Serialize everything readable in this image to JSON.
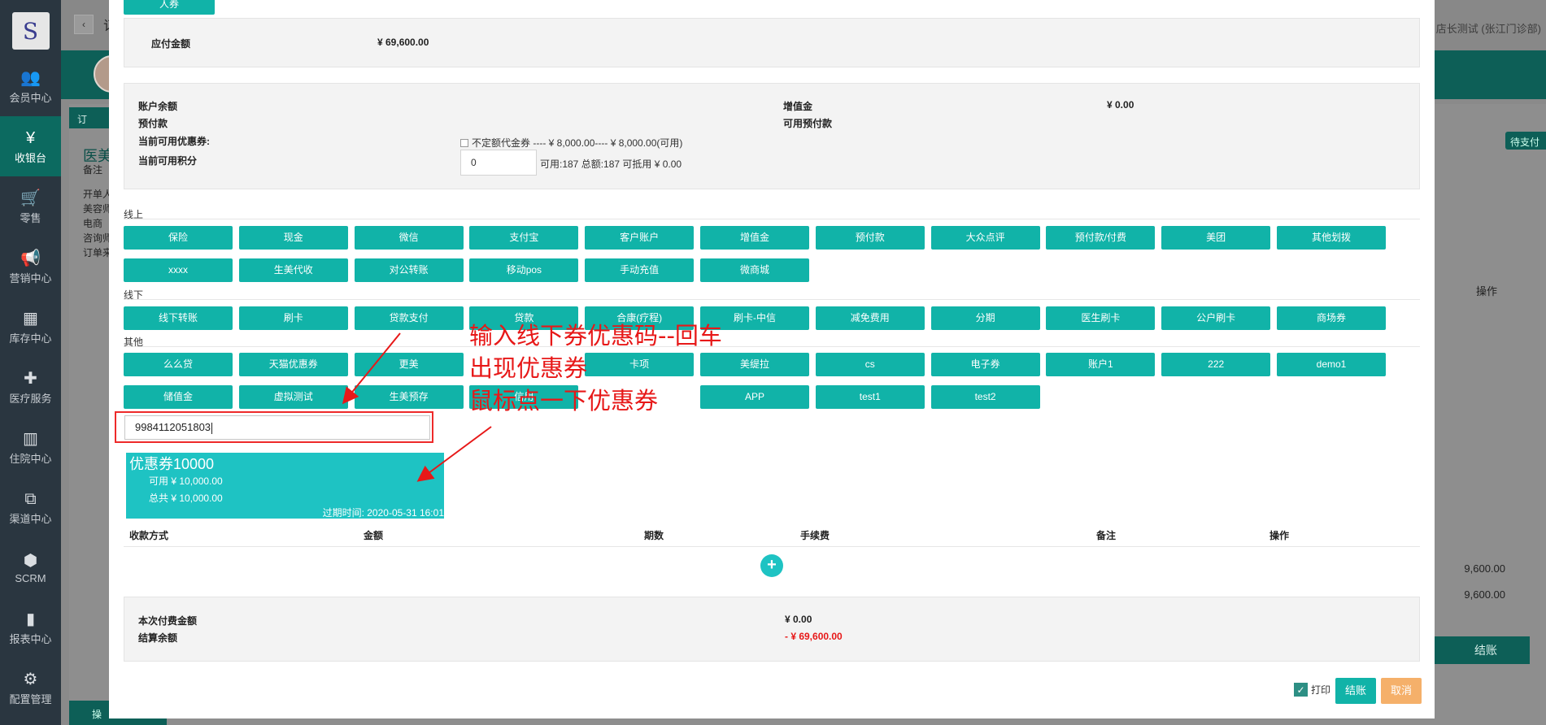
{
  "sidebar": {
    "logo_glyph": "S",
    "items": [
      {
        "label": "会员中心",
        "icon": "users-icon",
        "glyph": "👥"
      },
      {
        "label": "收银台",
        "icon": "yen-icon",
        "glyph": "¥"
      },
      {
        "label": "零售",
        "icon": "cart-icon",
        "glyph": "🛒"
      },
      {
        "label": "营销中心",
        "icon": "megaphone-icon",
        "glyph": "📢"
      },
      {
        "label": "库存中心",
        "icon": "grid-icon",
        "glyph": "▦"
      },
      {
        "label": "医疗服务",
        "icon": "medkit-icon",
        "glyph": "✚"
      },
      {
        "label": "住院中心",
        "icon": "building-icon",
        "glyph": "▥"
      },
      {
        "label": "渠道中心",
        "icon": "sitemap-icon",
        "glyph": "⧉"
      },
      {
        "label": "SCRM",
        "icon": "cubes-icon",
        "glyph": "⬢"
      },
      {
        "label": "报表中心",
        "icon": "bar-chart-icon",
        "glyph": "▮"
      },
      {
        "label": "配置管理",
        "icon": "gear-icon",
        "glyph": "⚙"
      }
    ]
  },
  "background": {
    "title_fragment": "订",
    "user_name": "店长测试 (张江门诊部)",
    "tab_fragment": "订",
    "card_title_fragment": "医美",
    "left_labels": [
      "备注",
      "",
      "开单人",
      "美容师",
      "电商",
      "咨询师",
      "订单来"
    ],
    "pending_badge": "待支付",
    "op_header": "操作",
    "amounts": [
      "9,600.00",
      "9,600.00"
    ],
    "checkout_label": "结账",
    "bottom_tab": "操"
  },
  "modal": {
    "top_button": "人券",
    "payable_label": "应付金额",
    "payable_value": "¥ 69,600.00",
    "account": {
      "balance_label": "账户余额",
      "prepaid_label": "预付款",
      "coupons_label": "当前可用优惠券:",
      "points_label": "当前可用积分",
      "value_added_label": "增值金",
      "value_added_value": "¥ 0.00",
      "usable_prepaid_label": "可用预付款",
      "coupon_option": "不定额代金券 ---- ¥ 8,000.00---- ¥ 8,000.00(可用)",
      "points_input": "0",
      "points_info": "可用:187 总额:187 可抵用 ¥ 0.00"
    },
    "online_label": "线上",
    "online_buttons": [
      "保险",
      "现金",
      "微信",
      "支付宝",
      "客户账户",
      "增值金",
      "预付款",
      "大众点评",
      "预付款/付费",
      "美团",
      "其他划拨",
      "xxxx",
      "生美代收",
      "对公转账",
      "移动pos",
      "手动充值",
      "微商城"
    ],
    "offline_label": "线下",
    "offline_buttons": [
      "线下转账",
      "刷卡",
      "贷款支付",
      "贷款",
      "合康(疗程)",
      "刷卡-中信",
      "减免费用",
      "分期",
      "医生刷卡",
      "公户刷卡",
      "商场券"
    ],
    "other_label": "其他",
    "other_buttons": [
      "么么贷",
      "天猫优惠券",
      "更美",
      "",
      "卡项",
      "美缇拉",
      "cs",
      "电子券",
      "账户1",
      "222",
      "demo1",
      "储值金",
      "虚拟测试",
      "生美预存",
      "信用",
      "",
      "APP",
      "test1",
      "test2"
    ],
    "coupon_code": "9984112051803",
    "coupon_card": {
      "title": "优惠券10000",
      "available": "可用 ¥ 10,000.00",
      "total": "总共 ¥ 10,000.00",
      "expiry": "过期时间: 2020-05-31 16:01"
    },
    "annotations": [
      "输入线下券优惠码--回车",
      "出现优惠券",
      "鼠标点一下优惠券"
    ],
    "table_headers": [
      "收款方式",
      "金额",
      "期数",
      "手续费",
      "备注",
      "操作"
    ],
    "add_glyph": "+",
    "summary": {
      "this_payment_label": "本次付费金额",
      "this_payment_value": "¥ 0.00",
      "balance_label": "结算余额",
      "balance_value": "- ¥ 69,600.00"
    },
    "print_label": "打印",
    "settle_label": "结账",
    "cancel_label": "取消"
  }
}
